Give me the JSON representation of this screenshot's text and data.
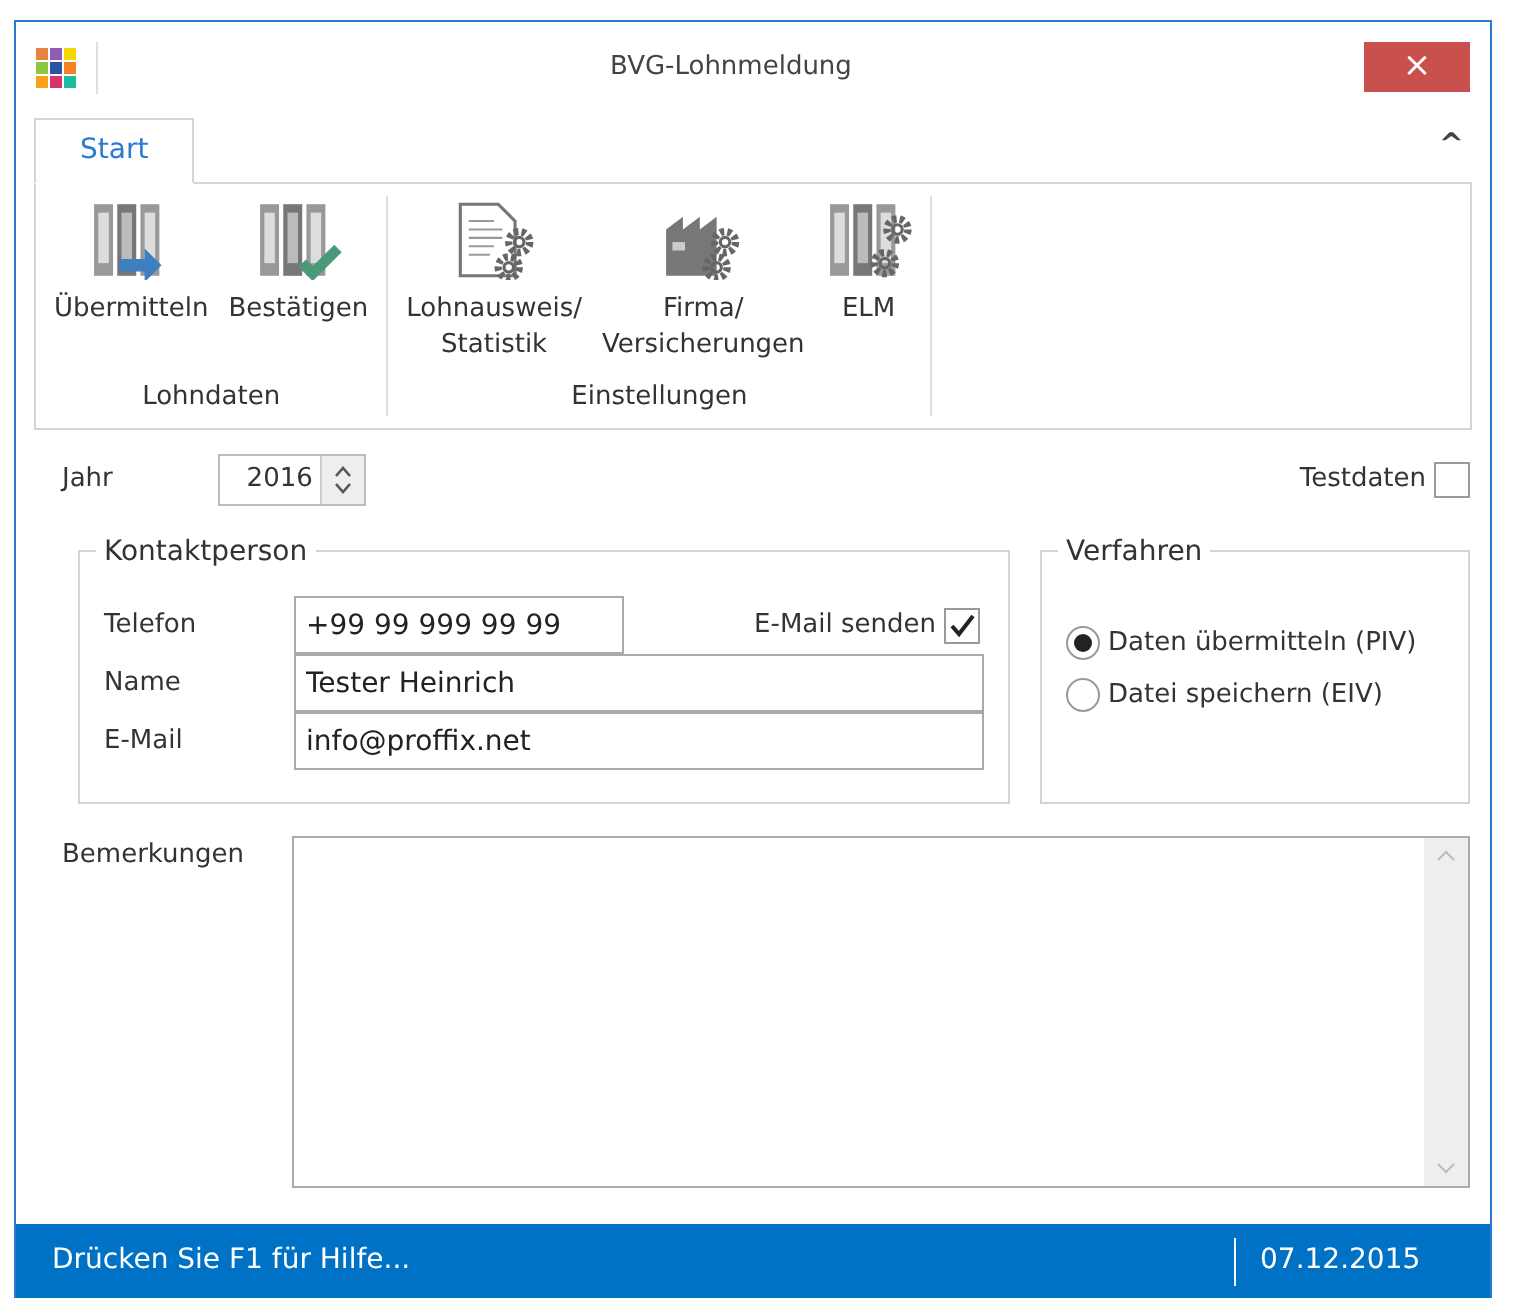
{
  "window": {
    "title": "BVG-Lohnmeldung",
    "close": "×"
  },
  "ribbon": {
    "collapse": "^",
    "tabs": [
      {
        "label": "Start",
        "selected": true
      }
    ],
    "groups": [
      {
        "label": "Lohndaten",
        "buttons": [
          {
            "kind": "send",
            "label": "Übermitteln"
          },
          {
            "kind": "confirm",
            "label": "Bestätigen"
          }
        ]
      },
      {
        "label": "Einstellungen",
        "buttons": [
          {
            "kind": "document",
            "label": "Lohnausweis/\nStatistik"
          },
          {
            "kind": "factory",
            "label": "Firma/\nVersicherungen"
          },
          {
            "kind": "binders",
            "label": "ELM"
          }
        ]
      }
    ]
  },
  "form": {
    "year": {
      "label": "Jahr",
      "value": "2016"
    },
    "testdaten": {
      "label": "Testdaten",
      "checked": false
    },
    "kontakt": {
      "legend": "Kontaktperson",
      "telefon": {
        "label": "Telefon",
        "value": "+99 99 999 99 99"
      },
      "email_senden": {
        "label": "E-Mail senden",
        "checked": true
      },
      "name": {
        "label": "Name",
        "value": "Tester Heinrich"
      },
      "email": {
        "label": "E-Mail",
        "value": "info@proffix.net"
      }
    },
    "verfahren": {
      "legend": "Verfahren",
      "options": [
        {
          "label": "Daten übermitteln (PIV)",
          "selected": true
        },
        {
          "label": "Datei speichern (EIV)",
          "selected": false
        }
      ]
    },
    "bemerkungen": {
      "label": "Bemerkungen"
    }
  },
  "status_bar": {
    "help": "Drücken Sie F1 für Hilfe...",
    "date": "07.12.2015"
  }
}
